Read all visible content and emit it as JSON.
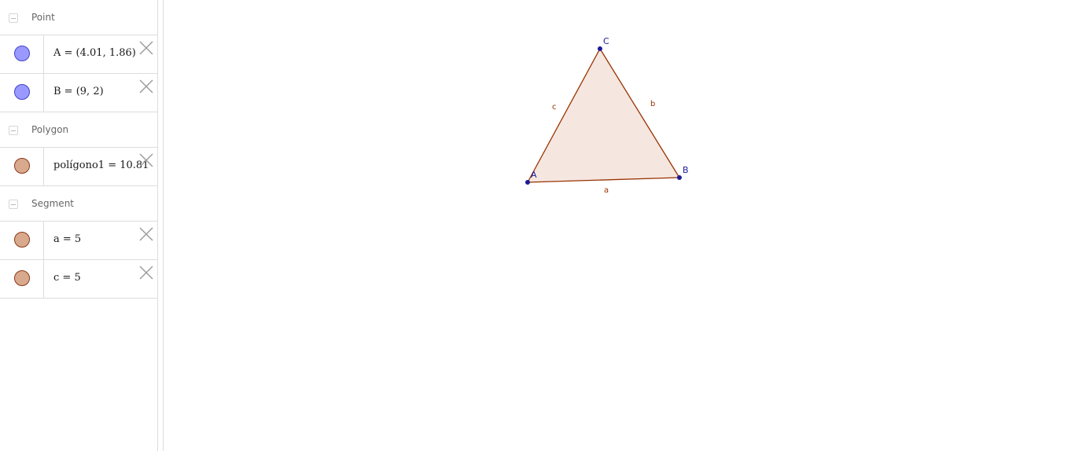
{
  "algebra": {
    "groups": [
      {
        "title": "Point",
        "items": [
          {
            "text": "A = (4.01, 1.86)",
            "color": "#9999ff",
            "border": "#3333cc",
            "deletable": true
          },
          {
            "text": "B = (9, 2)",
            "color": "#9999ff",
            "border": "#3333cc",
            "deletable": true
          }
        ]
      },
      {
        "title": "Polygon",
        "items": [
          {
            "text": "polígono1 = 10.81",
            "color": "#d8a98c",
            "border": "#8b3a1a",
            "deletable": true
          }
        ]
      },
      {
        "title": "Segment",
        "items": [
          {
            "text": "a = 5",
            "color": "#d8a98c",
            "border": "#8b3a1a",
            "deletable": true
          },
          {
            "text": "c = 5",
            "color": "#d8a98c",
            "border": "#8b3a1a",
            "deletable": true
          }
        ]
      }
    ]
  },
  "graphics": {
    "point_color": "#1a1a99",
    "segment_color": "#993300",
    "polygon_fill": "#f5e6e0",
    "points": {
      "A": {
        "label": "A"
      },
      "B": {
        "label": "B"
      },
      "C": {
        "label": "C"
      }
    },
    "segments": {
      "a": {
        "label": "a"
      },
      "b": {
        "label": "b"
      },
      "c": {
        "label": "c"
      }
    }
  }
}
